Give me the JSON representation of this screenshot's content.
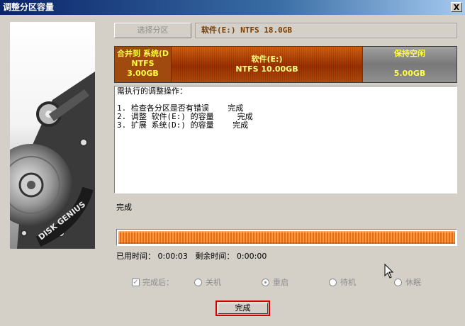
{
  "window": {
    "title": "调整分区容量",
    "close_label": "X"
  },
  "header": {
    "select_partition_label": "选择分区",
    "partition_info": "软件(E:) NTFS 18.0GB"
  },
  "partition_bar": {
    "segments": [
      {
        "line1": "合并到 系统(D",
        "line2": "NTFS",
        "line3": "3.00GB"
      },
      {
        "line1": "软件(E:)",
        "line2": "NTFS 10.00GB"
      },
      {
        "line1": "保持空闲",
        "line2": "",
        "line3": "5.00GB"
      }
    ]
  },
  "operations": {
    "heading": "需执行的调整操作：",
    "items": [
      {
        "index": "1.",
        "text": "检查各分区是否有错误",
        "status": "完成"
      },
      {
        "index": "2.",
        "text": "调整 软件(E:) 的容量",
        "status": "完成"
      },
      {
        "index": "3.",
        "text": "扩展 系统(D:) 的容量",
        "status": "完成"
      }
    ]
  },
  "status": {
    "text": "完成",
    "progress": 1.0
  },
  "timing": {
    "elapsed_label": "已用时间：",
    "elapsed_value": "0:00:03",
    "remaining_label": "剩余时间：",
    "remaining_value": "0:00:00"
  },
  "after_options": {
    "checkbox_label": "完成后：",
    "checked": true,
    "options": [
      "关机",
      "重启",
      "待机",
      "休眠"
    ],
    "selected": "重启"
  },
  "finish_button": {
    "label": "完成"
  },
  "brand": {
    "logo_text": "DISK GENIUS"
  }
}
